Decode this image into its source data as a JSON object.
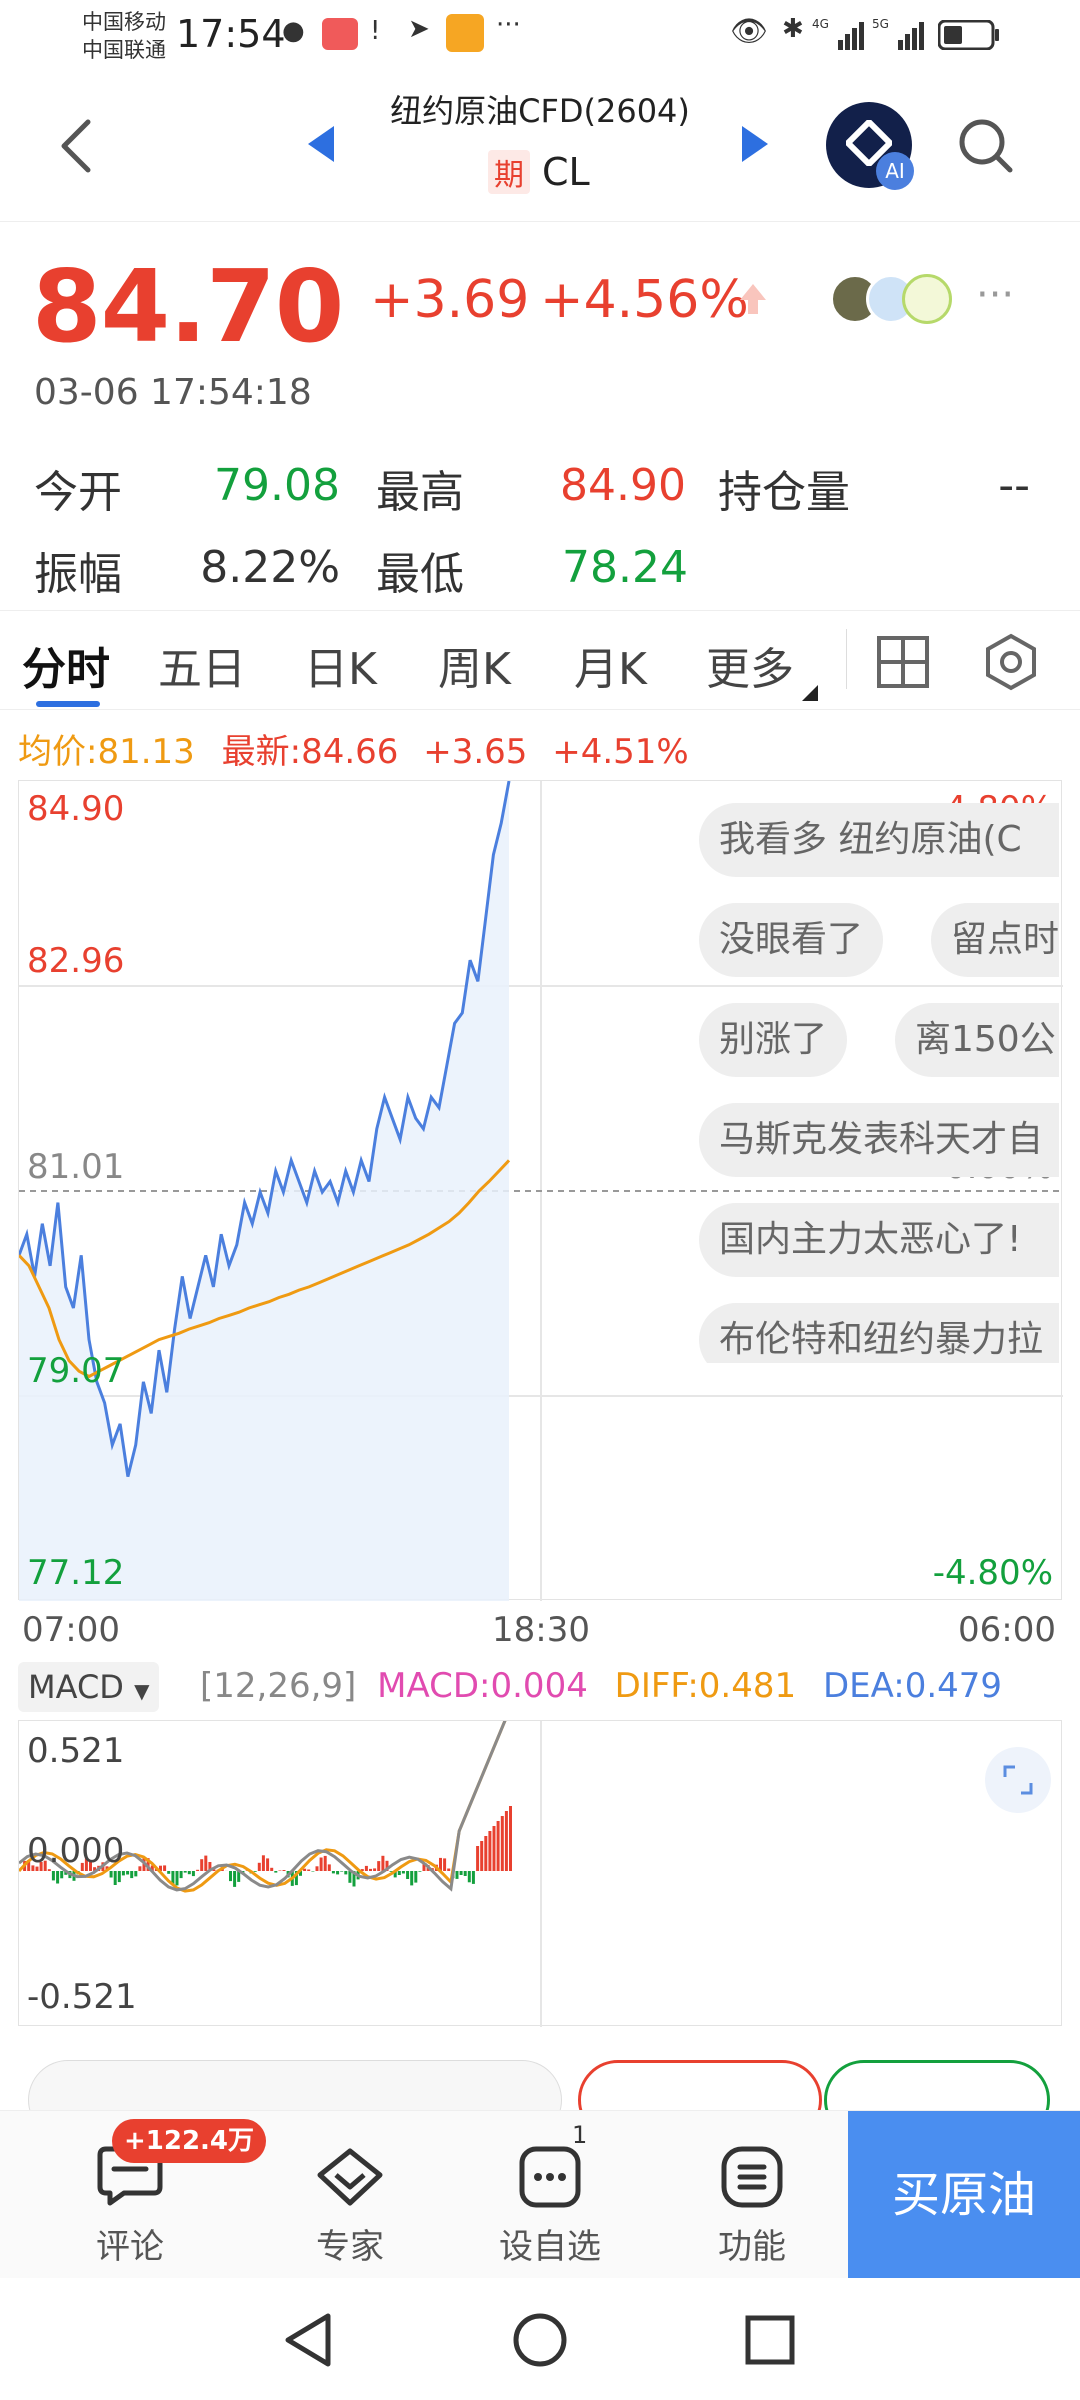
{
  "status_bar": {
    "carrier1": "中国移动",
    "carrier2": "中国联通",
    "time": "17:54",
    "battery_icon": "battery-icon",
    "signal_labels": [
      "4G",
      "5G"
    ]
  },
  "header": {
    "title": "纽约原油CFD(2604)",
    "badge": "期",
    "symbol": "CL",
    "ai_label": "AI"
  },
  "quote": {
    "price": "84.70",
    "change": "+3.69",
    "change_pct": "+4.56%",
    "datetime": "03-06 17:54:18",
    "stats": [
      {
        "label": "今开",
        "value": "79.08",
        "color": "green"
      },
      {
        "label": "最高",
        "value": "84.90",
        "color": "red"
      },
      {
        "label": "持仓量",
        "value": "--",
        "color": "normal"
      },
      {
        "label": "振幅",
        "value": "8.22%",
        "color": "normal"
      },
      {
        "label": "最低",
        "value": "78.24",
        "color": "green"
      }
    ]
  },
  "tabs": [
    "分时",
    "五日",
    "日K",
    "周K",
    "月K",
    "更多"
  ],
  "chart_info": {
    "avg_label": "均价:81.13",
    "latest_label": "最新:84.66",
    "latest_change": "+3.65",
    "latest_pct": "+4.51%"
  },
  "chart_data": {
    "type": "line",
    "y_labels_left": [
      "84.90",
      "82.96",
      "81.01",
      "79.07",
      "77.12"
    ],
    "y_labels_right": [
      "4.80%",
      "0.00%",
      "-4.80%"
    ],
    "x_labels": [
      "07:00",
      "18:30",
      "06:00"
    ],
    "ylim": [
      77.12,
      84.9
    ],
    "series": [],
    "price": [
      80.4,
      80.6,
      80.2,
      80.7,
      80.3,
      80.9,
      80.1,
      79.9,
      80.4,
      79.6,
      79.2,
      79.0,
      78.6,
      78.8,
      78.3,
      78.6,
      79.2,
      78.9,
      79.5,
      79.1,
      79.7,
      80.2,
      79.8,
      80.1,
      80.4,
      80.1,
      80.6,
      80.3,
      80.5,
      80.9,
      80.7,
      81.0,
      80.8,
      81.2,
      81.0,
      81.3,
      81.1,
      80.9,
      81.2,
      81.0,
      81.1,
      80.9,
      81.2,
      81.0,
      81.3,
      81.1,
      81.6,
      81.9,
      81.7,
      81.5,
      81.9,
      81.7,
      81.6,
      81.9,
      81.8,
      82.2,
      82.6,
      82.7,
      83.2,
      83.0,
      83.6,
      84.2,
      84.5,
      84.9
    ],
    "avg": [
      80.4,
      80.3,
      80.1,
      79.9,
      79.6,
      79.4,
      79.3,
      79.25,
      79.3,
      79.35,
      79.4,
      79.45,
      79.5,
      79.55,
      79.6,
      79.63,
      79.66,
      79.7,
      79.73,
      79.76,
      79.8,
      79.83,
      79.86,
      79.9,
      79.93,
      79.96,
      80.0,
      80.03,
      80.07,
      80.1,
      80.14,
      80.18,
      80.22,
      80.26,
      80.3,
      80.34,
      80.38,
      80.42,
      80.46,
      80.5,
      80.55,
      80.6,
      80.66,
      80.72,
      80.8,
      80.9,
      81.01,
      81.1,
      81.2,
      81.3
    ]
  },
  "comments": [
    "我看多 纽约原油(C",
    "没眼看了",
    "留点时",
    "别涨了",
    "离150公",
    "马斯克发表科天才自",
    "国内主力太恶心了!",
    "布伦特和纽约暴力拉"
  ],
  "macd": {
    "selector": "MACD",
    "params": "[12,26,9]",
    "macd": "MACD:0.004",
    "diff": "DIFF:0.481",
    "dea": "DEA:0.479",
    "y_top": "0.521",
    "y_mid": "0.000",
    "y_bottom": "-0.521"
  },
  "bottom_nav": {
    "comment_badge": "+122.4万",
    "comment": "评论",
    "expert": "专家",
    "watchlist": "设自选",
    "watch_badge": "1",
    "function": "功能",
    "buy": "买原油"
  }
}
